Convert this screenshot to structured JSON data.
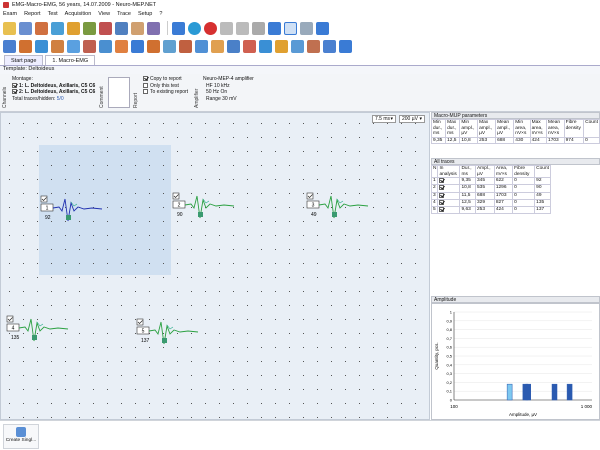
{
  "window": {
    "title": "EMG-Macro-EMG, 56 years, 14.07.2009 - Neuro-MEP.NET"
  },
  "menu": [
    "Exam",
    "Report",
    "Test",
    "Acquisition",
    "View",
    "Trace",
    "Setup",
    "?"
  ],
  "tabs": [
    {
      "label": "Start page"
    },
    {
      "label": "1. Macro-EMG"
    }
  ],
  "template": "Template: Deltoideus",
  "channels": {
    "label": "Channels",
    "montage_label": "Montage:",
    "items": [
      "1: L. Deltoideus, Axillaris, C5 C6",
      "2: L. Deltoideus, Axillaris, C5 C6"
    ],
    "total_traces_label": "Total traces/hidden:",
    "total_traces_value": "5/0"
  },
  "comment": {
    "label": "Comment"
  },
  "report": {
    "label": "Report",
    "options": [
      {
        "label": "Copy to report",
        "checked": true
      },
      {
        "label": "Only this test",
        "checked": false
      },
      {
        "label": "To existing report",
        "checked": false
      }
    ]
  },
  "amplifier": {
    "label": "Amplifier",
    "title": "Neuro-MEP-4 amplifier",
    "lines": [
      "HF 10 kHz",
      "50 Hz On",
      "Range 30 mV"
    ]
  },
  "graph": {
    "timebase": "7.5 ms",
    "sensitivity": "200 µV",
    "traces": [
      {
        "id": "1",
        "count": "92"
      },
      {
        "id": "2",
        "count": "90"
      },
      {
        "id": "3",
        "count": "49"
      },
      {
        "id": "4",
        "count": "135"
      },
      {
        "id": "5",
        "count": "137"
      }
    ]
  },
  "params": {
    "title": "Macro-MUP parameters",
    "headers": [
      "Min dur., ms",
      "Max dur., ms",
      "Min ampl., µV",
      "Max ampl., µV",
      "Mean ampl., µV",
      "Min area, nV×s",
      "Max area, nV×s",
      "Mean area, nV×s",
      "Fibre density",
      "Count"
    ],
    "values": [
      "9,35",
      "12,5",
      "10,8",
      "253",
      "688",
      "430",
      "424",
      "1703",
      "974",
      "0"
    ]
  },
  "all_traces": {
    "title": "All traces",
    "headers": [
      "N",
      "In analysis",
      "Dur., ms",
      "Ampl., µV",
      "Area, nV×s",
      "Fibre density",
      "Count"
    ],
    "rows": [
      [
        "1",
        "",
        "9,35",
        "345",
        "622",
        "0",
        "92"
      ],
      [
        "2",
        "",
        "10,8",
        "535",
        "1296",
        "0",
        "90"
      ],
      [
        "3",
        "",
        "11,5",
        "688",
        "1703",
        "0",
        "49"
      ],
      [
        "4",
        "",
        "12,5",
        "329",
        "827",
        "0",
        "135"
      ],
      [
        "5",
        "",
        "9,63",
        "253",
        "424",
        "0",
        "137"
      ]
    ]
  },
  "amplitude": {
    "title": "Amplitude",
    "ylabel": "Quantity, pcs.",
    "xlabel": "Amplitude, µV",
    "yticks": [
      "1",
      "0,9",
      "0,8",
      "0,7",
      "0,6",
      "0,5",
      "0,4",
      "0,3",
      "0,2",
      "0,1",
      "0"
    ],
    "xticks": [
      "100",
      "1 000"
    ]
  },
  "status": {
    "button_label": "Create Singl..."
  },
  "colors": {
    "accent": "#3a7bd5",
    "selection": "#c9dcf0",
    "trace_green": "#2aa040",
    "trace_blue": "#2030b0",
    "trace_dark": "#223"
  },
  "chart_data": {
    "type": "bar",
    "title": "Amplitude",
    "xlabel": "Amplitude, µV",
    "ylabel": "Quantity, pcs.",
    "xscale": "log",
    "xlim": [
      100,
      1000
    ],
    "ylim": [
      0,
      1
    ],
    "grid": true,
    "bars": [
      {
        "x": 253,
        "value": 1,
        "highlighted": true
      },
      {
        "x": 345,
        "value": 1,
        "highlighted": false
      },
      {
        "x": 535,
        "value": 1,
        "highlighted": false
      },
      {
        "x": 688,
        "value": 1,
        "highlighted": false
      },
      {
        "x": 329,
        "value": 1,
        "highlighted": false
      }
    ]
  }
}
